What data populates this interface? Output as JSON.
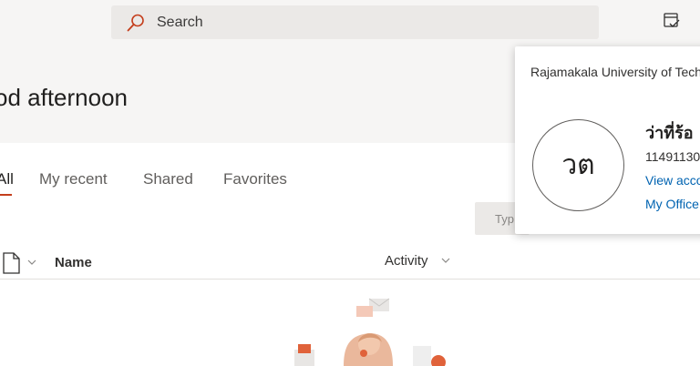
{
  "search": {
    "label": "Search",
    "icon": "search-icon"
  },
  "header": {
    "right_icon": "feedback-icon"
  },
  "greeting": "od afternoon",
  "tabs": [
    {
      "label": "All",
      "selected": true
    },
    {
      "label": "My recent",
      "selected": false
    },
    {
      "label": "Shared",
      "selected": false
    },
    {
      "label": "Favorites",
      "selected": false
    }
  ],
  "filter": {
    "placeholder": "Typ"
  },
  "list_header": {
    "name": "Name",
    "activity": "Activity",
    "file_icon": "file-icon"
  },
  "account_card": {
    "org": "Rajamakala University of Tech",
    "initials": "วต",
    "display_name": "ว่าที่ร้อ",
    "user_id": "11491130",
    "view_account": "View acco",
    "my_office": "My Office"
  },
  "colors": {
    "accent": "#c43e1c",
    "link": "#0063b1",
    "band": "#f6f5f4"
  }
}
